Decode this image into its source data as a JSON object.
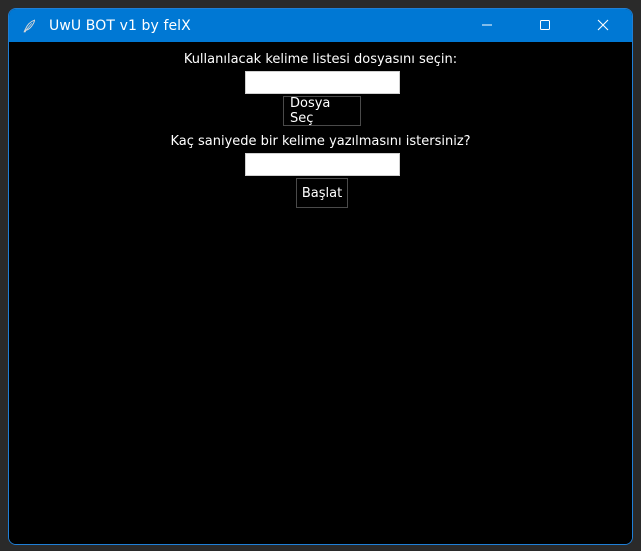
{
  "window": {
    "title": "UwU BOT v1 by felX",
    "icons": {
      "app": "feather-icon",
      "minimize": "minimize-icon",
      "maximize": "maximize-icon",
      "close": "close-icon"
    },
    "colors": {
      "titlebar": "#0078d4",
      "background": "#000000",
      "text": "#ffffff"
    }
  },
  "form": {
    "file_label": "Kullanılacak kelime listesi dosyasını seçin:",
    "file_value": "",
    "file_button": "Dosya Seç",
    "interval_label": "Kaç saniyede bir kelime yazılmasını istersiniz?",
    "interval_value": "",
    "start_button": "Başlat"
  }
}
